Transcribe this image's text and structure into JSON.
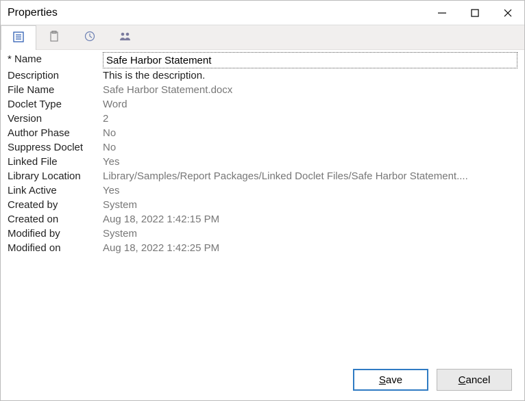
{
  "window": {
    "title": "Properties"
  },
  "tabs": [
    {
      "icon": "details-icon",
      "active": true
    },
    {
      "icon": "clipboard-icon",
      "active": false
    },
    {
      "icon": "clock-icon",
      "active": false
    },
    {
      "icon": "people-icon",
      "active": false
    }
  ],
  "fields": {
    "name": {
      "label": "* Name",
      "value": "Safe Harbor Statement",
      "editable": true,
      "input": true
    },
    "description": {
      "label": "Description",
      "value": "This is the description.",
      "editable": true
    },
    "fileName": {
      "label": "File Name",
      "value": "Safe Harbor Statement.docx"
    },
    "docletType": {
      "label": "Doclet Type",
      "value": "Word"
    },
    "version": {
      "label": "Version",
      "value": "2"
    },
    "authorPhase": {
      "label": "Author Phase",
      "value": "No"
    },
    "suppressDoclet": {
      "label": "Suppress Doclet",
      "value": "No"
    },
    "linkedFile": {
      "label": "Linked File",
      "value": "Yes"
    },
    "libraryLocation": {
      "label": "Library Location",
      "value": "Library/Samples/Report Packages/Linked Doclet Files/Safe Harbor Statement...."
    },
    "linkActive": {
      "label": "Link Active",
      "value": "Yes"
    },
    "createdBy": {
      "label": "Created by",
      "value": "System"
    },
    "createdOn": {
      "label": "Created on",
      "value": "Aug 18, 2022 1:42:15 PM"
    },
    "modifiedBy": {
      "label": "Modified by",
      "value": "System"
    },
    "modifiedOn": {
      "label": "Modified on",
      "value": "Aug 18, 2022 1:42:25 PM"
    }
  },
  "buttons": {
    "save": "Save",
    "cancel": "Cancel"
  }
}
